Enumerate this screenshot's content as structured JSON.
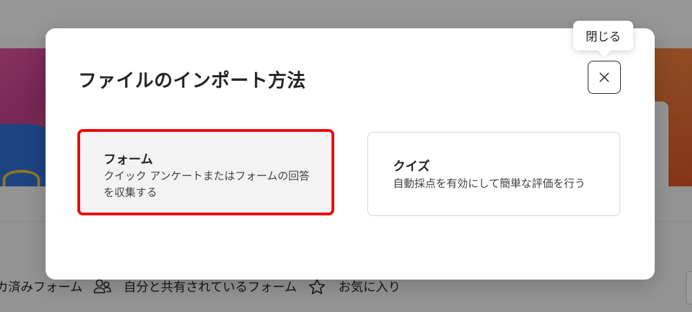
{
  "background": {
    "tabs": [
      {
        "label": "カ済みフォーム",
        "icon": "none"
      },
      {
        "label": "自分と共有されているフォーム",
        "icon": "people-icon"
      },
      {
        "label": "お気に入り",
        "icon": "star-icon"
      }
    ]
  },
  "dialog": {
    "title": "ファイルのインポート方法",
    "close_tooltip": "閉じる",
    "close_icon": "close-icon",
    "options": [
      {
        "title": "フォーム",
        "description": "クイック アンケートまたはフォームの回答を収集する",
        "highlighted": true
      },
      {
        "title": "クイズ",
        "description": "自動採点を有効にして簡単な評価を行う",
        "highlighted": false
      }
    ]
  },
  "colors": {
    "highlight_border": "#ee0000",
    "overlay": "rgba(0,0,0,0.40)",
    "dialog_bg": "#ffffff",
    "text_primary": "#242424"
  }
}
